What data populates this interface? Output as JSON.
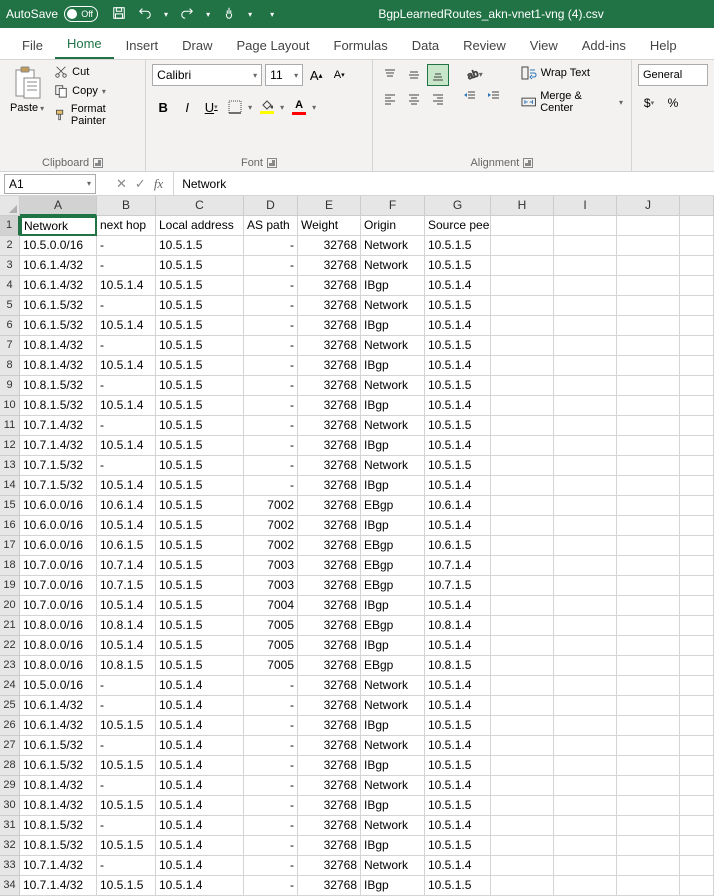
{
  "title": {
    "autosave_label": "AutoSave",
    "autosave_state": "Off",
    "filename": "BgpLearnedRoutes_akn-vnet1-vng (4).csv"
  },
  "tabs": {
    "file": "File",
    "home": "Home",
    "insert": "Insert",
    "draw": "Draw",
    "page_layout": "Page Layout",
    "formulas": "Formulas",
    "data": "Data",
    "review": "Review",
    "view": "View",
    "addins": "Add-ins",
    "help": "Help"
  },
  "ribbon": {
    "clipboard": {
      "paste": "Paste",
      "cut": "Cut",
      "copy": "Copy",
      "format_painter": "Format Painter",
      "label": "Clipboard"
    },
    "font": {
      "name": "Calibri",
      "size": "11",
      "label": "Font"
    },
    "alignment": {
      "wrap": "Wrap Text",
      "merge": "Merge & Center",
      "label": "Alignment"
    },
    "number": {
      "format": "General"
    }
  },
  "namebox": "A1",
  "formula_value": "Network",
  "columns": [
    "A",
    "B",
    "C",
    "D",
    "E",
    "F",
    "G",
    "H",
    "I",
    "J"
  ],
  "headers": [
    "Network",
    "next hop",
    "Local address",
    "AS path",
    "Weight",
    "Origin",
    "Source peer"
  ],
  "rows": [
    [
      "10.5.0.0/16",
      "-",
      "10.5.1.5",
      "-",
      "32768",
      "Network",
      "10.5.1.5"
    ],
    [
      "10.6.1.4/32",
      "-",
      "10.5.1.5",
      "-",
      "32768",
      "Network",
      "10.5.1.5"
    ],
    [
      "10.6.1.4/32",
      "10.5.1.4",
      "10.5.1.5",
      "-",
      "32768",
      "IBgp",
      "10.5.1.4"
    ],
    [
      "10.6.1.5/32",
      "-",
      "10.5.1.5",
      "-",
      "32768",
      "Network",
      "10.5.1.5"
    ],
    [
      "10.6.1.5/32",
      "10.5.1.4",
      "10.5.1.5",
      "-",
      "32768",
      "IBgp",
      "10.5.1.4"
    ],
    [
      "10.8.1.4/32",
      "-",
      "10.5.1.5",
      "-",
      "32768",
      "Network",
      "10.5.1.5"
    ],
    [
      "10.8.1.4/32",
      "10.5.1.4",
      "10.5.1.5",
      "-",
      "32768",
      "IBgp",
      "10.5.1.4"
    ],
    [
      "10.8.1.5/32",
      "-",
      "10.5.1.5",
      "-",
      "32768",
      "Network",
      "10.5.1.5"
    ],
    [
      "10.8.1.5/32",
      "10.5.1.4",
      "10.5.1.5",
      "-",
      "32768",
      "IBgp",
      "10.5.1.4"
    ],
    [
      "10.7.1.4/32",
      "-",
      "10.5.1.5",
      "-",
      "32768",
      "Network",
      "10.5.1.5"
    ],
    [
      "10.7.1.4/32",
      "10.5.1.4",
      "10.5.1.5",
      "-",
      "32768",
      "IBgp",
      "10.5.1.4"
    ],
    [
      "10.7.1.5/32",
      "-",
      "10.5.1.5",
      "-",
      "32768",
      "Network",
      "10.5.1.5"
    ],
    [
      "10.7.1.5/32",
      "10.5.1.4",
      "10.5.1.5",
      "-",
      "32768",
      "IBgp",
      "10.5.1.4"
    ],
    [
      "10.6.0.0/16",
      "10.6.1.4",
      "10.5.1.5",
      "7002",
      "32768",
      "EBgp",
      "10.6.1.4"
    ],
    [
      "10.6.0.0/16",
      "10.5.1.4",
      "10.5.1.5",
      "7002",
      "32768",
      "IBgp",
      "10.5.1.4"
    ],
    [
      "10.6.0.0/16",
      "10.6.1.5",
      "10.5.1.5",
      "7002",
      "32768",
      "EBgp",
      "10.6.1.5"
    ],
    [
      "10.7.0.0/16",
      "10.7.1.4",
      "10.5.1.5",
      "7003",
      "32768",
      "EBgp",
      "10.7.1.4"
    ],
    [
      "10.7.0.0/16",
      "10.7.1.5",
      "10.5.1.5",
      "7003",
      "32768",
      "EBgp",
      "10.7.1.5"
    ],
    [
      "10.7.0.0/16",
      "10.5.1.4",
      "10.5.1.5",
      "7004",
      "32768",
      "IBgp",
      "10.5.1.4"
    ],
    [
      "10.8.0.0/16",
      "10.8.1.4",
      "10.5.1.5",
      "7005",
      "32768",
      "EBgp",
      "10.8.1.4"
    ],
    [
      "10.8.0.0/16",
      "10.5.1.4",
      "10.5.1.5",
      "7005",
      "32768",
      "IBgp",
      "10.5.1.4"
    ],
    [
      "10.8.0.0/16",
      "10.8.1.5",
      "10.5.1.5",
      "7005",
      "32768",
      "EBgp",
      "10.8.1.5"
    ],
    [
      "10.5.0.0/16",
      "-",
      "10.5.1.4",
      "-",
      "32768",
      "Network",
      "10.5.1.4"
    ],
    [
      "10.6.1.4/32",
      "-",
      "10.5.1.4",
      "-",
      "32768",
      "Network",
      "10.5.1.4"
    ],
    [
      "10.6.1.4/32",
      "10.5.1.5",
      "10.5.1.4",
      "-",
      "32768",
      "IBgp",
      "10.5.1.5"
    ],
    [
      "10.6.1.5/32",
      "-",
      "10.5.1.4",
      "-",
      "32768",
      "Network",
      "10.5.1.4"
    ],
    [
      "10.6.1.5/32",
      "10.5.1.5",
      "10.5.1.4",
      "-",
      "32768",
      "IBgp",
      "10.5.1.5"
    ],
    [
      "10.8.1.4/32",
      "-",
      "10.5.1.4",
      "-",
      "32768",
      "Network",
      "10.5.1.4"
    ],
    [
      "10.8.1.4/32",
      "10.5.1.5",
      "10.5.1.4",
      "-",
      "32768",
      "IBgp",
      "10.5.1.5"
    ],
    [
      "10.8.1.5/32",
      "-",
      "10.5.1.4",
      "-",
      "32768",
      "Network",
      "10.5.1.4"
    ],
    [
      "10.8.1.5/32",
      "10.5.1.5",
      "10.5.1.4",
      "-",
      "32768",
      "IBgp",
      "10.5.1.5"
    ],
    [
      "10.7.1.4/32",
      "-",
      "10.5.1.4",
      "-",
      "32768",
      "Network",
      "10.5.1.4"
    ],
    [
      "10.7.1.4/32",
      "10.5.1.5",
      "10.5.1.4",
      "-",
      "32768",
      "IBgp",
      "10.5.1.5"
    ]
  ]
}
